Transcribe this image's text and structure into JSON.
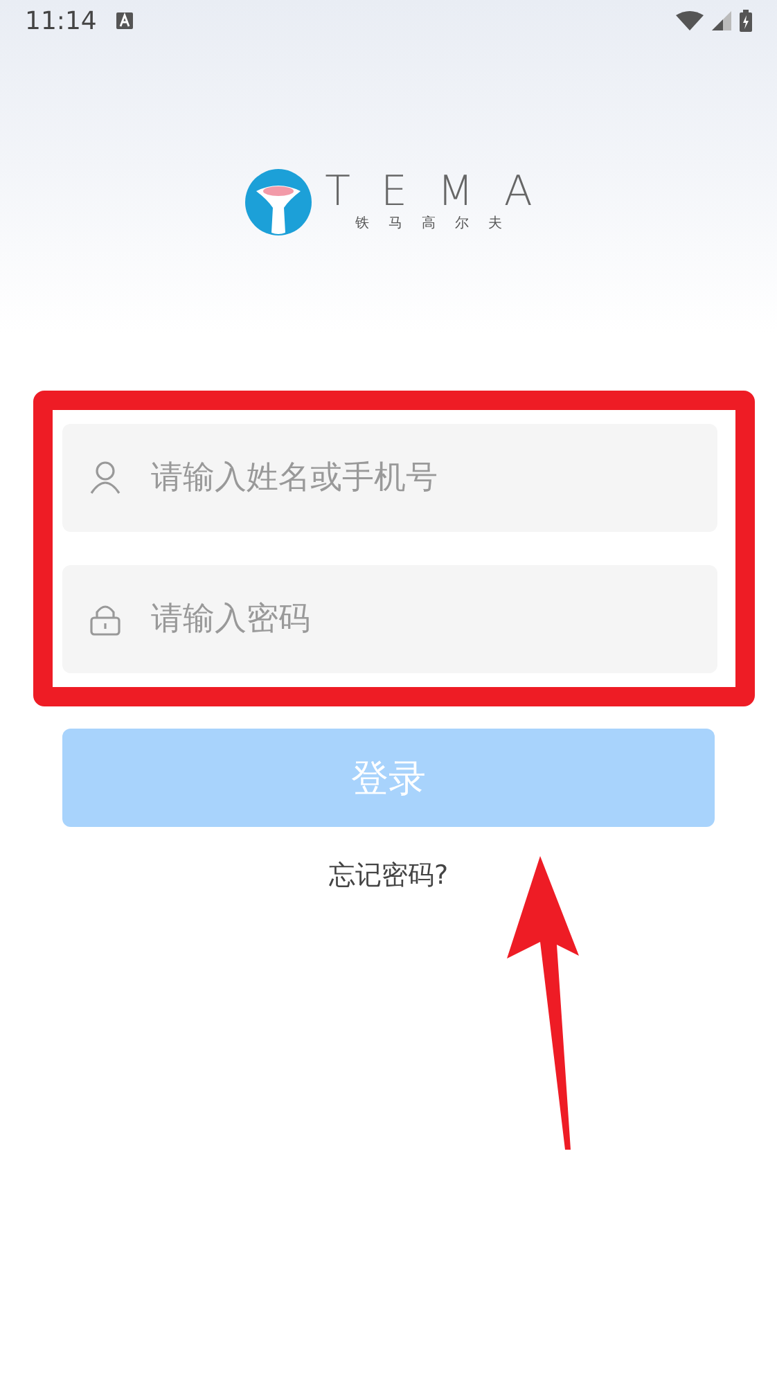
{
  "status_bar": {
    "time": "11:14"
  },
  "logo": {
    "wordmark": "TEMA",
    "subtitle": "铁马高尔夫"
  },
  "form": {
    "username": {
      "placeholder": "请输入姓名或手机号"
    },
    "password": {
      "placeholder": "请输入密码"
    },
    "login_button": {
      "label": "登录",
      "disabled": true
    },
    "forgot_link": "忘记密码?"
  }
}
